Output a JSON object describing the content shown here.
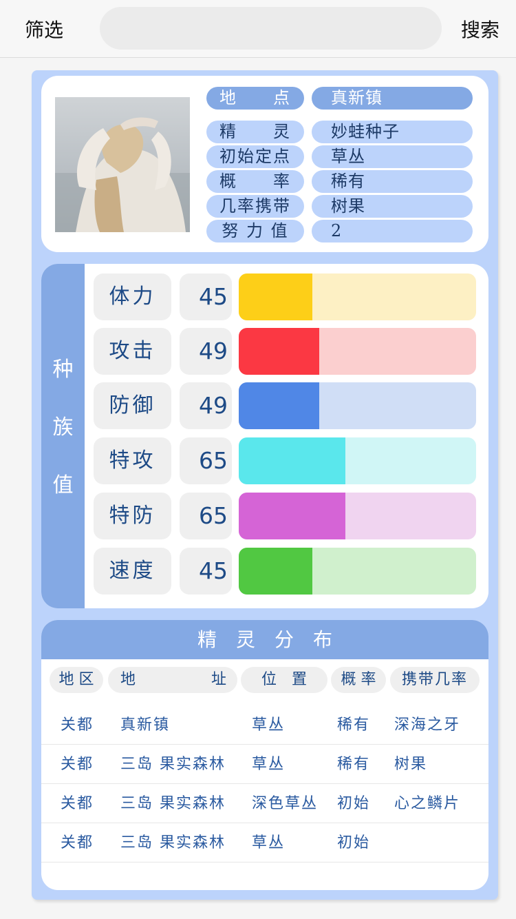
{
  "topbar": {
    "filter_label": "筛选",
    "search_placeholder": "",
    "search_label": "搜索"
  },
  "info": {
    "header": {
      "label": "地　　点",
      "value": "真新镇"
    },
    "rows": [
      {
        "label": "精　　灵",
        "value": "妙蛙种子"
      },
      {
        "label": "初始定点",
        "value": "草丛"
      },
      {
        "label": "概　　率",
        "value": "稀有"
      },
      {
        "label": "几率携带",
        "value": "树果"
      },
      {
        "label": "努 力 值",
        "value": "2"
      }
    ]
  },
  "stats": {
    "title_chars": [
      "种",
      "族",
      "值"
    ],
    "max": 145,
    "items": [
      {
        "name": "体力",
        "value": 45,
        "color": "#fdcf18",
        "bg": "#fdf0c4"
      },
      {
        "name": "攻击",
        "value": 49,
        "color": "#fb3843",
        "bg": "#fbcfcf"
      },
      {
        "name": "防御",
        "value": 49,
        "color": "#5087e6",
        "bg": "#d0def6"
      },
      {
        "name": "特攻",
        "value": 65,
        "color": "#5ae7ec",
        "bg": "#d0f6f6"
      },
      {
        "name": "特防",
        "value": 65,
        "color": "#d564d6",
        "bg": "#f0d4f0"
      },
      {
        "name": "速度",
        "value": 45,
        "color": "#51c842",
        "bg": "#d0f0cd"
      }
    ]
  },
  "distribution": {
    "title": "精灵分布",
    "headers": {
      "region": "地 区",
      "address_a": "地",
      "address_b": "址",
      "position": "位　置",
      "rate": "概 率",
      "carry": "携带几率"
    },
    "rows": [
      {
        "region": "关都",
        "address": "真新镇",
        "position": "草丛",
        "rate": "稀有",
        "carry": "深海之牙"
      },
      {
        "region": "关都",
        "address": "三岛 果实森林",
        "position": "草丛",
        "rate": "稀有",
        "carry": "树果"
      },
      {
        "region": "关都",
        "address": "三岛 果实森林",
        "position": "深色草丛",
        "rate": "初始",
        "carry": "心之鳞片"
      },
      {
        "region": "关都",
        "address": "三岛 果实森林",
        "position": "草丛",
        "rate": "初始",
        "carry": ""
      }
    ]
  }
}
